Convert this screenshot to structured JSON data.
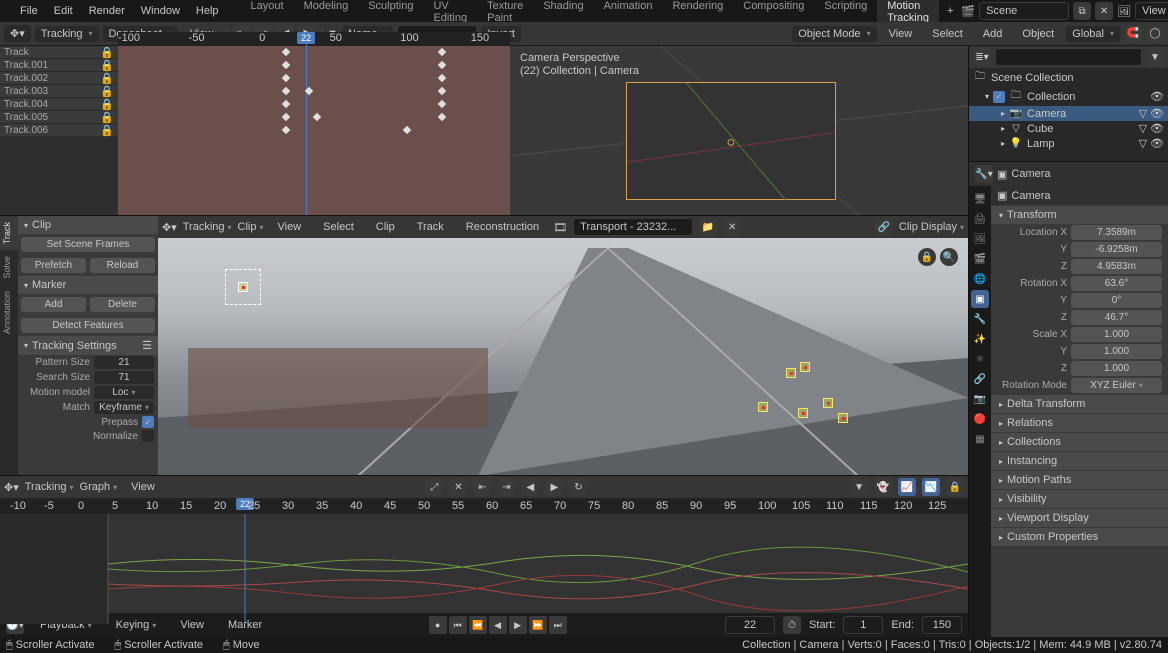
{
  "menus": [
    "File",
    "Edit",
    "Render",
    "Window",
    "Help"
  ],
  "workspaces": [
    "Layout",
    "Modeling",
    "Sculpting",
    "UV Editing",
    "Texture Paint",
    "Shading",
    "Animation",
    "Rendering",
    "Compositing",
    "Scripting",
    "Motion Tracking"
  ],
  "active_workspace": "Motion Tracking",
  "scene_name": "Scene",
  "viewlayer_name": "View Layer",
  "dopesheet": {
    "mode": "Tracking",
    "editor": "Dopesheet",
    "view": "View",
    "ruler": [
      "-100",
      "-50",
      "0",
      "50",
      "100",
      "150"
    ],
    "current_frame": "22",
    "tracks": [
      "Track",
      "Track.001",
      "Track.002",
      "Track.003",
      "Track.004",
      "Track.005",
      "Track.006"
    ]
  },
  "viewport3d_header": {
    "mode": "Object Mode",
    "view": "View",
    "select": "Select",
    "add": "Add",
    "object": "Object",
    "orientation": "Global"
  },
  "viewport3d_overlay": {
    "line1": "Camera Perspective",
    "line2": "(22) Collection | Camera"
  },
  "clip_header": {
    "mode": "Tracking",
    "editor": "Clip",
    "view": "View",
    "select": "Select",
    "clip": "Clip",
    "track": "Track",
    "recon": "Reconstruction",
    "clip_name": "Transport - 23232...",
    "display": "Clip Display"
  },
  "side_tabs": [
    "Track",
    "Solve",
    "Annotation"
  ],
  "clip_panel": {
    "clip_hdr": "Clip",
    "set_scene": "Set Scene Frames",
    "prefetch": "Prefetch",
    "reload": "Reload",
    "marker_hdr": "Marker",
    "add": "Add",
    "delete": "Delete",
    "detect": "Detect Features",
    "settings_hdr": "Tracking Settings",
    "pattern_lbl": "Pattern Size",
    "pattern_val": "21",
    "search_lbl": "Search Size",
    "search_val": "71",
    "motion_lbl": "Motion model",
    "motion_val": "Loc",
    "match_lbl": "Match",
    "match_val": "Keyframe",
    "prepass_lbl": "Prepass",
    "normalize_lbl": "Normalize"
  },
  "graph": {
    "mode": "Tracking",
    "editor": "Graph",
    "view": "View",
    "ruler": [
      "-10",
      "-5",
      "0",
      "5",
      "10",
      "15",
      "20",
      "25",
      "30",
      "35",
      "40",
      "45",
      "50",
      "55",
      "60",
      "65",
      "70",
      "75",
      "80",
      "85",
      "90",
      "95",
      "100",
      "105",
      "110",
      "115",
      "120",
      "125"
    ],
    "current_frame": "22"
  },
  "timeline": {
    "playback": "Playback",
    "keying": "Keying",
    "view": "View",
    "marker": "Marker",
    "current": "22",
    "start_lbl": "Start:",
    "start": "1",
    "end_lbl": "End:",
    "end": "150"
  },
  "outliner": {
    "root": "Scene Collection",
    "collection": "Collection",
    "items": [
      {
        "name": "Camera",
        "icon": "📷",
        "sel": true
      },
      {
        "name": "Cube",
        "icon": "▽",
        "sel": false
      },
      {
        "name": "Lamp",
        "icon": "💡",
        "sel": false
      }
    ]
  },
  "properties": {
    "breadcrumb": "Camera",
    "obj": "Camera",
    "transform_hdr": "Transform",
    "loc": {
      "x": "7.3589m",
      "y": "-6.9258m",
      "z": "4.9583m"
    },
    "rot": {
      "x": "63.6°",
      "y": "0°",
      "z": "46.7°"
    },
    "scale": {
      "x": "1.000",
      "y": "1.000",
      "z": "1.000"
    },
    "rotmode_lbl": "Rotation Mode",
    "rotmode": "XYZ Euler",
    "sections": [
      "Delta Transform",
      "Relations",
      "Collections",
      "Instancing",
      "Motion Paths",
      "Visibility",
      "Viewport Display",
      "Custom Properties"
    ]
  },
  "status": {
    "left1": "Scroller Activate",
    "left2": "Scroller Activate",
    "left3": "Move",
    "right": "Collection | Camera | Verts:0 | Faces:0 | Tris:0 | Objects:1/2 | Mem: 44.9 MB | v2.80.74"
  },
  "invert_btn": "Invert",
  "name_lbl": "Name"
}
